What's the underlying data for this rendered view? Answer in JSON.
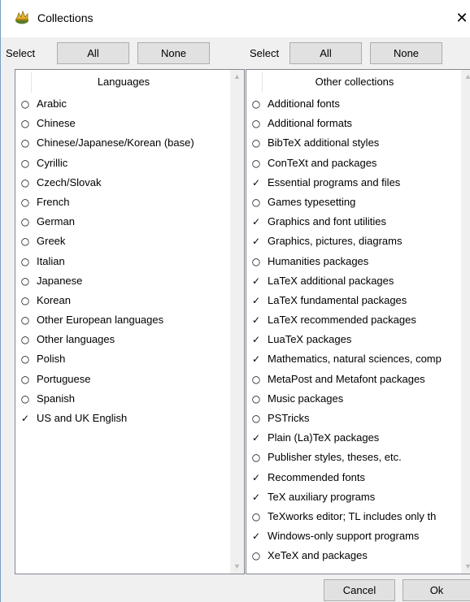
{
  "window": {
    "title": "Collections",
    "close_glyph": "✕"
  },
  "left": {
    "select_label": "Select",
    "all_label": "All",
    "none_label": "None",
    "header": "Languages",
    "items": [
      {
        "label": "Arabic",
        "checked": false
      },
      {
        "label": "Chinese",
        "checked": false
      },
      {
        "label": "Chinese/Japanese/Korean (base)",
        "checked": false
      },
      {
        "label": "Cyrillic",
        "checked": false
      },
      {
        "label": "Czech/Slovak",
        "checked": false
      },
      {
        "label": "French",
        "checked": false
      },
      {
        "label": "German",
        "checked": false
      },
      {
        "label": "Greek",
        "checked": false
      },
      {
        "label": "Italian",
        "checked": false
      },
      {
        "label": "Japanese",
        "checked": false
      },
      {
        "label": "Korean",
        "checked": false
      },
      {
        "label": "Other European languages",
        "checked": false
      },
      {
        "label": "Other languages",
        "checked": false
      },
      {
        "label": "Polish",
        "checked": false
      },
      {
        "label": "Portuguese",
        "checked": false
      },
      {
        "label": "Spanish",
        "checked": false
      },
      {
        "label": "US and UK English",
        "checked": true
      }
    ]
  },
  "right": {
    "select_label": "Select",
    "all_label": "All",
    "none_label": "None",
    "header": "Other collections",
    "items": [
      {
        "label": "Additional fonts",
        "checked": false
      },
      {
        "label": "Additional formats",
        "checked": false
      },
      {
        "label": "BibTeX additional styles",
        "checked": false
      },
      {
        "label": "ConTeXt and packages",
        "checked": false
      },
      {
        "label": "Essential programs and files",
        "checked": true
      },
      {
        "label": "Games typesetting",
        "checked": false
      },
      {
        "label": "Graphics and font utilities",
        "checked": true
      },
      {
        "label": "Graphics, pictures, diagrams",
        "checked": true
      },
      {
        "label": "Humanities packages",
        "checked": false
      },
      {
        "label": "LaTeX additional packages",
        "checked": true
      },
      {
        "label": "LaTeX fundamental packages",
        "checked": true
      },
      {
        "label": "LaTeX recommended packages",
        "checked": true
      },
      {
        "label": "LuaTeX packages",
        "checked": true
      },
      {
        "label": "Mathematics, natural sciences, comp",
        "checked": true
      },
      {
        "label": "MetaPost and Metafont packages",
        "checked": false
      },
      {
        "label": "Music packages",
        "checked": false
      },
      {
        "label": "PSTricks",
        "checked": false
      },
      {
        "label": "Plain (La)TeX packages",
        "checked": true
      },
      {
        "label": "Publisher styles, theses, etc.",
        "checked": false
      },
      {
        "label": "Recommended fonts",
        "checked": true
      },
      {
        "label": "TeX auxiliary programs",
        "checked": true
      },
      {
        "label": "TeXworks editor; TL includes only th",
        "checked": false
      },
      {
        "label": "Windows-only support programs",
        "checked": true
      },
      {
        "label": "XeTeX and packages",
        "checked": false
      }
    ]
  },
  "footer": {
    "cancel_label": "Cancel",
    "ok_label": "Ok"
  },
  "glyphs": {
    "checked": "✓",
    "unchecked": "○"
  },
  "icons": {
    "app": "collections-icon",
    "close": "close-icon",
    "scroll_up": "scroll-up-arrow-icon",
    "scroll_down": "scroll-down-arrow-icon"
  },
  "colors": {
    "panel_border": "#828790",
    "button_bg": "#e1e1e1",
    "button_border": "#adadad",
    "window_bg": "#f0f0f0"
  }
}
